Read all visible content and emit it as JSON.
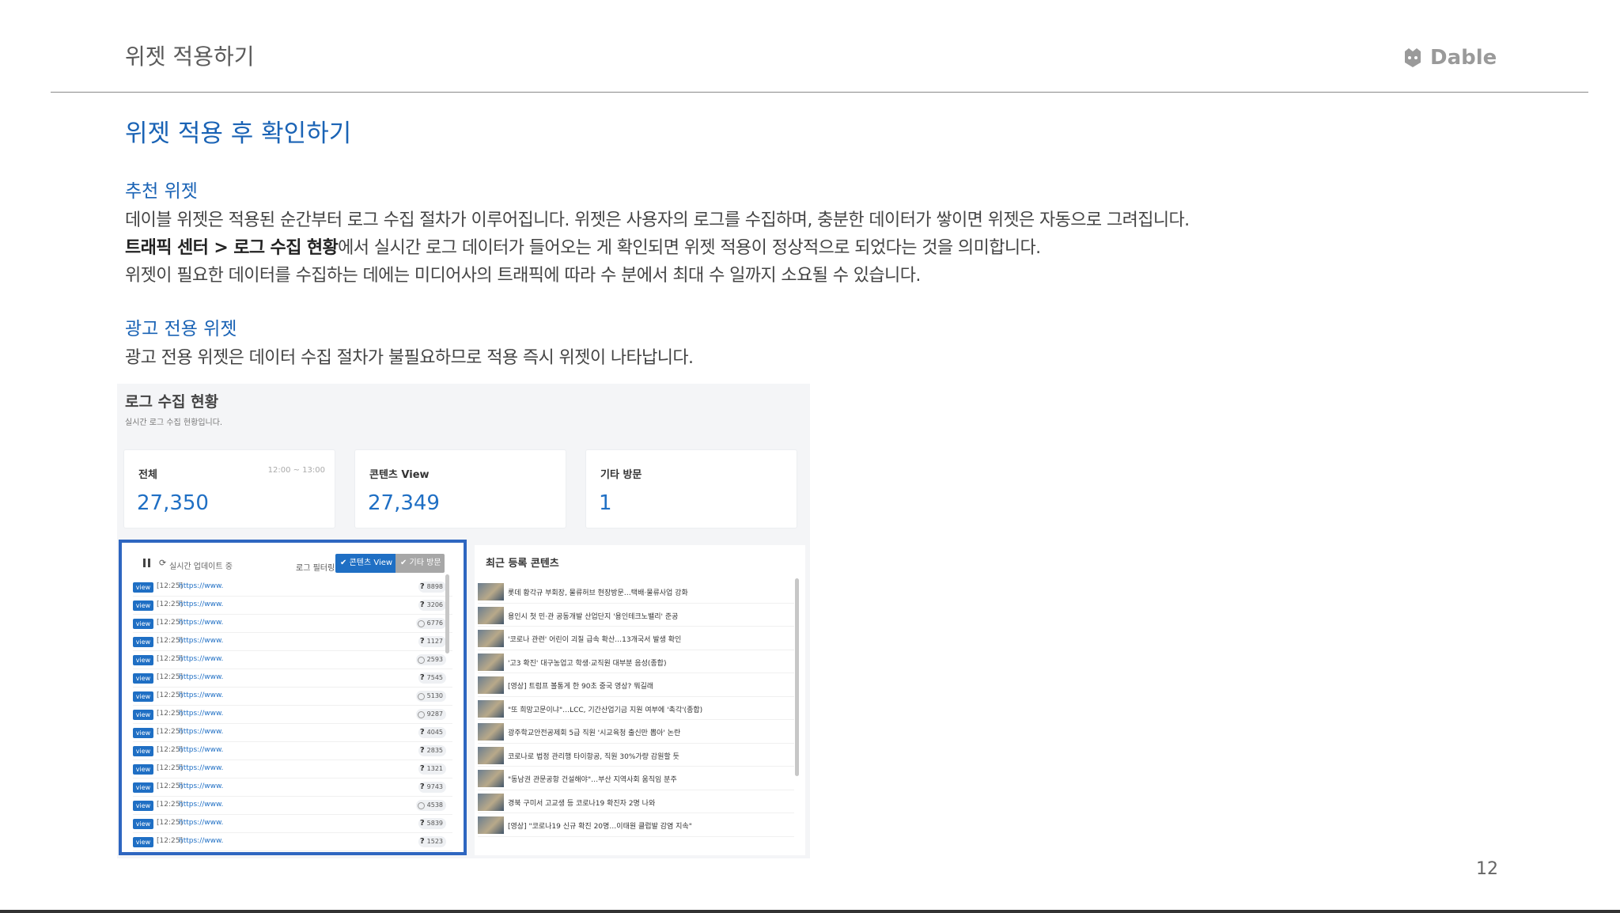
{
  "header": {
    "title": "위젯 적용하기",
    "logo_text": "Dable",
    "page_number": "12"
  },
  "section": {
    "title": "위젯 적용 후 확인하기",
    "recommend": {
      "heading": "추천 위젯",
      "line1": "데이블 위젯은 적용된 순간부터 로그 수집 절차가 이루어집니다. 위젯은 사용자의 로그를 수집하며, 충분한 데이터가 쌓이면 위젯은 자동으로 그려집니다.",
      "line2_bold": "트래픽 센터 > 로그 수집 현황",
      "line2_rest": "에서 실시간 로그 데이터가 들어오는 게 확인되면 위젯 적용이 정상적으로 되었다는 것을 의미합니다.",
      "line3": "위젯이 필요한 데이터를 수집하는 데에는 미디어사의 트래픽에 따라 수 분에서 최대 수 일까지 소요될 수 있습니다."
    },
    "ad": {
      "heading": "광고 전용 위젯",
      "line1": "광고 전용 위젯은 데이터 수집 절차가 불필요하므로 적용 즉시 위젯이 나타납니다."
    }
  },
  "screenshot": {
    "title": "로그 수집 현황",
    "subtitle": "실시간 로그 수집 현황입니다.",
    "stats": [
      {
        "label": "전체",
        "time": "12:00 ~ 13:00",
        "value": "27,350"
      },
      {
        "label": "콘텐츠 View",
        "time": "",
        "value": "27,349"
      },
      {
        "label": "기타 방문",
        "time": "",
        "value": "1"
      }
    ],
    "log": {
      "realtime_label": "실시간 업데이트 중",
      "filter_label": "로그 필터링:",
      "chip_content": "✔ 콘텐츠 View",
      "chip_other": "✔ 기타 방문",
      "rows": [
        {
          "badge": "view",
          "time": "[12:25]",
          "url": "https://www.",
          "icon": "q",
          "count": "8898"
        },
        {
          "badge": "view",
          "time": "[12:25]",
          "url": "https://www.",
          "icon": "q",
          "count": "3206"
        },
        {
          "badge": "view",
          "time": "[12:25]",
          "url": "https://www.",
          "icon": "t",
          "count": "6776"
        },
        {
          "badge": "view",
          "time": "[12:25]",
          "url": "https://www.",
          "icon": "q",
          "count": "1127"
        },
        {
          "badge": "view",
          "time": "[12:25]",
          "url": "https://www.",
          "icon": "t",
          "count": "2593"
        },
        {
          "badge": "view",
          "time": "[12:25]",
          "url": "https://www.",
          "icon": "q",
          "count": "7545"
        },
        {
          "badge": "view",
          "time": "[12:25]",
          "url": "https://www.",
          "icon": "t",
          "count": "5130"
        },
        {
          "badge": "view",
          "time": "[12:25]",
          "url": "https://www.",
          "icon": "t",
          "count": "9287"
        },
        {
          "badge": "view",
          "time": "[12:25]",
          "url": "https://www.",
          "icon": "q",
          "count": "4045"
        },
        {
          "badge": "view",
          "time": "[12:25]",
          "url": "https://www.",
          "icon": "q",
          "count": "2835"
        },
        {
          "badge": "view",
          "time": "[12:25]",
          "url": "https://www.",
          "icon": "q",
          "count": "1321"
        },
        {
          "badge": "view",
          "time": "[12:25]",
          "url": "https://www.",
          "icon": "q",
          "count": "9743"
        },
        {
          "badge": "view",
          "time": "[12:25]",
          "url": "https://www.",
          "icon": "t",
          "count": "4538"
        },
        {
          "badge": "view",
          "time": "[12:25]",
          "url": "https://www.",
          "icon": "q",
          "count": "5839"
        },
        {
          "badge": "view",
          "time": "[12:25]",
          "url": "https://www.",
          "icon": "q",
          "count": "1523"
        }
      ]
    },
    "news": {
      "title": "최근 등록 콘텐츠",
      "items": [
        "롯데 황각규 부회장, 물류허브 현장방문…택배·물류사업 강화",
        "용인시 첫 민·관 공동개발 산업단지 '용인테크노밸리' 준공",
        "'코로나 관련' 어린이 괴질 급속 확산…13개국서 발생 확인",
        "'고3 확진' 대구농업고 학생·교직원 대부분 음성(종합)",
        "[영상] 트럼프 볼통게 한 90초 중국 영상? 뭐길래",
        "\"또 희망고문이냐\"…LCC, 기간산업기금 지원 여부에 '촉각'(종합)",
        "광주학교안전공제회 5급 직원 '시교육청 출신만 뽑아' 논란",
        "코로나로 법정 관리행 타이항공, 직원 30%가량 감원할 듯",
        "\"동남권 관문공항 건설해야\"…부산 지역사회 움직임 분주",
        "경북 구미서 고교생 등 코로나19 확진자 2명 나와",
        "[영상] \"코로나19 신규 확진 20명…이태원 클럽발 감염 지속\""
      ]
    }
  },
  "colors": {
    "accent": "#1a63b5",
    "highlight_border": "#2e66c0",
    "view_badge": "#1f6fc4"
  }
}
